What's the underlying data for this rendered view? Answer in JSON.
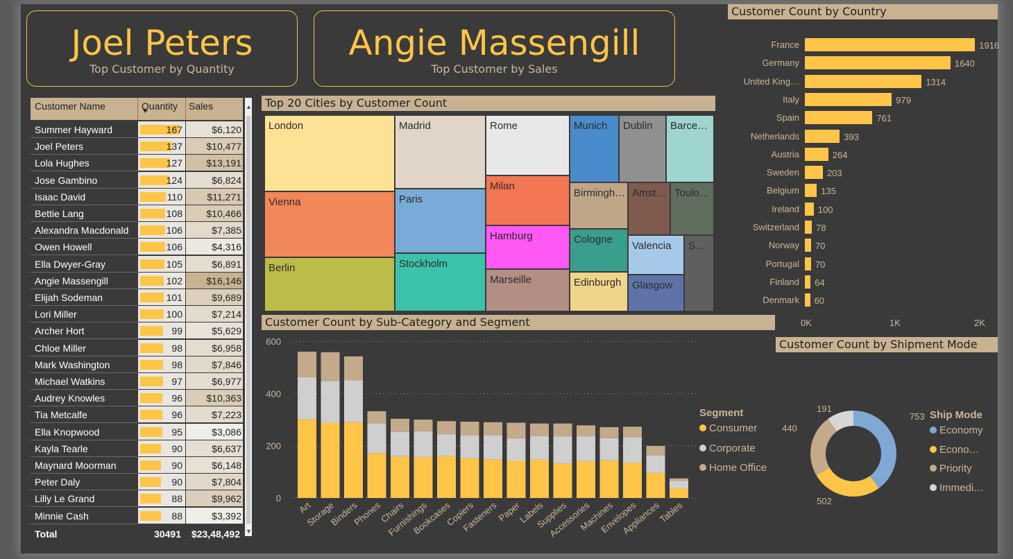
{
  "cards": [
    {
      "name": "Joel Peters",
      "caption": "Top Customer by Quantity"
    },
    {
      "name": "Angie Massengill",
      "caption": "Top Customer by Sales"
    }
  ],
  "table": {
    "headers": [
      "Customer Name",
      "Quantity",
      "Sales"
    ],
    "rows": [
      {
        "name": "Summer Hayward",
        "qty": "167",
        "sales": "$6,120"
      },
      {
        "name": "Joel Peters",
        "qty": "137",
        "sales": "$10,477"
      },
      {
        "name": "Lola Hughes",
        "qty": "127",
        "sales": "$13,191"
      },
      {
        "name": "Jose Gambino",
        "qty": "124",
        "sales": "$6,824"
      },
      {
        "name": "Isaac David",
        "qty": "110",
        "sales": "$11,271"
      },
      {
        "name": "Bettie Lang",
        "qty": "108",
        "sales": "$10,466"
      },
      {
        "name": "Alexandra Macdonald",
        "qty": "106",
        "sales": "$7,385"
      },
      {
        "name": "Owen Howell",
        "qty": "106",
        "sales": "$4,316"
      },
      {
        "name": "Ella Dwyer-Gray",
        "qty": "105",
        "sales": "$6,891"
      },
      {
        "name": "Angie Massengill",
        "qty": "102",
        "sales": "$16,146"
      },
      {
        "name": "Elijah Sodeman",
        "qty": "101",
        "sales": "$9,689"
      },
      {
        "name": "Lori Miller",
        "qty": "100",
        "sales": "$7,214"
      },
      {
        "name": "Archer Hort",
        "qty": "99",
        "sales": "$5,629"
      },
      {
        "name": "Chloe Miller",
        "qty": "98",
        "sales": "$6,958"
      },
      {
        "name": "Mark Washington",
        "qty": "98",
        "sales": "$7,846"
      },
      {
        "name": "Michael Watkins",
        "qty": "97",
        "sales": "$6,977"
      },
      {
        "name": "Audrey Knowles",
        "qty": "96",
        "sales": "$10,363"
      },
      {
        "name": "Tia Metcalfe",
        "qty": "96",
        "sales": "$7,223"
      },
      {
        "name": "Ella Knopwood",
        "qty": "95",
        "sales": "$3,086"
      },
      {
        "name": "Kayla Tearle",
        "qty": "90",
        "sales": "$6,637"
      },
      {
        "name": "Maynard Moorman",
        "qty": "90",
        "sales": "$6,148"
      },
      {
        "name": "Peter Daly",
        "qty": "90",
        "sales": "$7,804"
      },
      {
        "name": "Lilly Le Grand",
        "qty": "88",
        "sales": "$9,962"
      },
      {
        "name": "Minnie Cash",
        "qty": "88",
        "sales": "$3,392"
      }
    ],
    "total": {
      "label": "Total",
      "qty": "30491",
      "sales": "$23,48,492"
    }
  },
  "colors": {
    "accent": "#ffc548",
    "tan": "#c8b291",
    "corporate": "#cfcfcf",
    "home_office": "#c2aa8a",
    "economy": "#7fa8d4"
  },
  "chart_data": [
    {
      "type": "treemap",
      "title": "Top 20 Cities by Customer Count",
      "labels": [
        "London",
        "Madrid",
        "Rome",
        "Munich",
        "Dublin",
        "Barce…",
        "Vienna",
        "Paris",
        "Milan",
        "Birmingh…",
        "Amst…",
        "Toulo…",
        "Hamburg",
        "Cologne",
        "Valencia",
        "S…",
        "Berlin",
        "Stockholm",
        "Marseille",
        "Edinburgh",
        "Glasgow"
      ]
    },
    {
      "type": "bar",
      "orientation": "horizontal",
      "title": "Customer Count by Country",
      "categories": [
        "France",
        "Germany",
        "United King…",
        "Italy",
        "Spain",
        "Netherlands",
        "Austria",
        "Sweden",
        "Belgium",
        "Ireland",
        "Switzerland",
        "Norway",
        "Portugal",
        "Finland",
        "Denmark"
      ],
      "values": [
        1916,
        1640,
        1314,
        979,
        761,
        393,
        264,
        203,
        135,
        100,
        78,
        70,
        70,
        64,
        60
      ],
      "value_labels": [
        "1916",
        "1640",
        "1314",
        "979",
        "761",
        "393",
        "264",
        "203",
        "135",
        "100",
        "78",
        "70",
        "70",
        "64",
        "60"
      ],
      "xlim": [
        0,
        2000
      ],
      "xticks": [
        "0K",
        "1K",
        "2K"
      ]
    },
    {
      "type": "bar",
      "stacked": true,
      "title": "Customer Count by Sub-Category and Segment",
      "categories": [
        "Art",
        "Storage",
        "Binders",
        "Phones",
        "Chairs",
        "Furnishings",
        "Bookcases",
        "Copiers",
        "Fasteners",
        "Paper",
        "Labels",
        "Supplies",
        "Accessories",
        "Machines",
        "Envelopes",
        "Appliances",
        "Tables"
      ],
      "series": [
        {
          "name": "Consumer",
          "color": "#ffc548",
          "values": [
            302,
            288,
            290,
            172,
            160,
            157,
            160,
            152,
            148,
            142,
            147,
            132,
            141,
            144,
            135,
            96,
            37
          ]
        },
        {
          "name": "Corporate",
          "color": "#cfcfcf",
          "values": [
            160,
            160,
            160,
            114,
            93,
            98,
            84,
            88,
            92,
            86,
            90,
            103,
            95,
            85,
            98,
            67,
            28
          ]
        },
        {
          "name": "Home Office",
          "color": "#c2aa8a",
          "values": [
            98,
            110,
            92,
            46,
            50,
            45,
            50,
            52,
            50,
            60,
            48,
            50,
            42,
            42,
            40,
            36,
            10
          ]
        }
      ],
      "legend_title": "Segment",
      "ylim": [
        0,
        600
      ],
      "yticks": [
        "0",
        "200",
        "400",
        "600"
      ],
      "grid": true
    },
    {
      "type": "pie",
      "donut": true,
      "title": "Customer Count by Shipment Mode",
      "legend_title": "Ship Mode",
      "labels": [
        "Economy",
        "Econo…",
        "Priority",
        "Immedi…"
      ],
      "values": [
        753,
        502,
        440,
        191
      ],
      "value_labels": [
        "753",
        "502",
        "440",
        "191"
      ],
      "colors": [
        "#7fa8d4",
        "#ffc548",
        "#c2aa8a",
        "#d6d6d6"
      ]
    }
  ]
}
